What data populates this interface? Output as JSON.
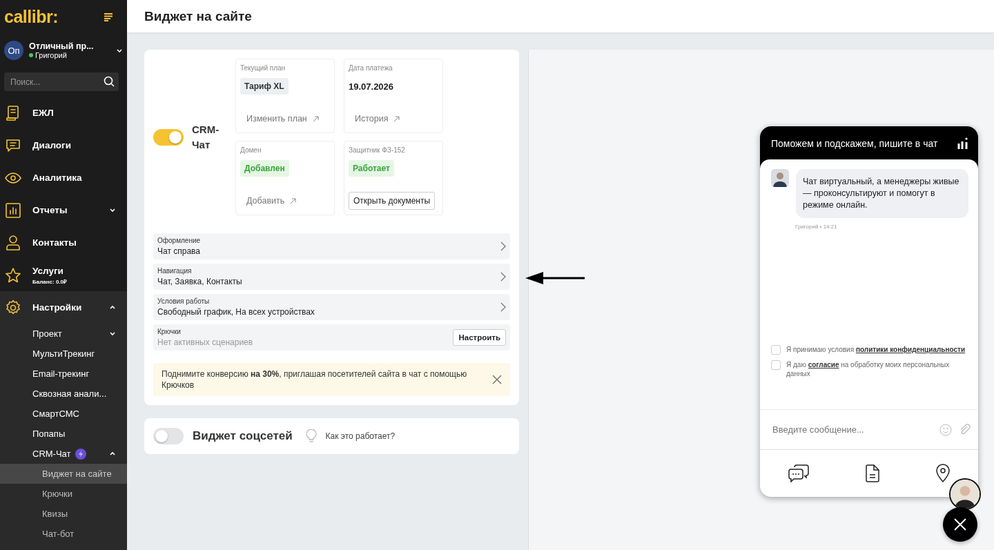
{
  "sidebar": {
    "logo": "callibr:",
    "account": {
      "initials": "Оп",
      "name": "Отличный пр...",
      "user": "Григорий",
      "online": true
    },
    "search": {
      "placeholder": "Поиск..."
    },
    "items": [
      {
        "label": "ЕЖЛ"
      },
      {
        "label": "Диалоги"
      },
      {
        "label": "Аналитика"
      },
      {
        "label": "Отчеты",
        "expanded": false
      },
      {
        "label": "Контакты"
      },
      {
        "label": "Услуги",
        "sublabel": "Баланс: 0.0₽"
      },
      {
        "label": "Настройки",
        "expanded": true,
        "children": [
          {
            "label": "Проект",
            "expanded": false
          },
          {
            "label": "МультиТрекинг"
          },
          {
            "label": "Email-трекинг"
          },
          {
            "label": "Сквозная анали..."
          },
          {
            "label": "СмартСМС"
          },
          {
            "label": "Попапы"
          },
          {
            "label": "CRM-Чат",
            "badge": true,
            "expanded": true,
            "children": [
              {
                "label": "Виджет на сайте",
                "selected": true
              },
              {
                "label": "Крючки",
                "selected": false
              },
              {
                "label": "Квизы",
                "selected": false
              },
              {
                "label": "Чат-бот",
                "selected": false
              }
            ]
          }
        ]
      }
    ]
  },
  "header": {
    "title": "Виджет на сайте"
  },
  "crm_card": {
    "toggle": {
      "on": true,
      "label": "CRM-Чат"
    },
    "tiles": [
      {
        "label": "Текущий план",
        "value": "Тариф XL",
        "kind": "tag",
        "action": {
          "kind": "link",
          "label": "Изменить план"
        }
      },
      {
        "label": "Дата платежа",
        "value": "19.07.2026",
        "kind": "text",
        "action": {
          "kind": "link",
          "label": "История"
        }
      },
      {
        "label": "Домен",
        "value": "Добавлен",
        "kind": "success",
        "action": {
          "kind": "link",
          "label": "Добавить"
        }
      },
      {
        "label": "Защитник ФЗ-152",
        "value": "Работает",
        "kind": "success",
        "action": {
          "kind": "button",
          "label": "Открыть документы"
        }
      }
    ],
    "rows": [
      {
        "label": "Оформление",
        "value": "Чат справа",
        "kind": "link"
      },
      {
        "label": "Навигация",
        "value": "Чат, Заявка, Контакты",
        "kind": "link"
      },
      {
        "label": "Условия работы",
        "value": "Свободный график, На всех устройствах",
        "kind": "link"
      },
      {
        "label": "Крючки",
        "value": "Нет активных сценариев",
        "kind": "button",
        "button": "Настроить"
      }
    ],
    "notice": "Поднимите конверсию **на 30%**, приглашая посетителей сайта в чат с помощью Крючков"
  },
  "social_card": {
    "toggle": {
      "on": false,
      "label": "Виджет соцсетей"
    },
    "help": "Как это работает?"
  },
  "chat_widget": {
    "title": "Поможем и подскажем, пишите в чат",
    "message": {
      "text": "Чат виртуальный, а менеджеры живые — проконсультируют и помогут в режиме онлайн.",
      "meta": "Григорий • 14:21"
    },
    "consents": [
      {
        "before": "Я принимаю условия ",
        "link": "политики конфиденциальности",
        "checked": false
      },
      {
        "before": "Я даю ",
        "link": "согласие",
        "after": " на обработку моих персональных данных",
        "checked": false
      }
    ],
    "input": {
      "placeholder": "Введите сообщение..."
    }
  }
}
